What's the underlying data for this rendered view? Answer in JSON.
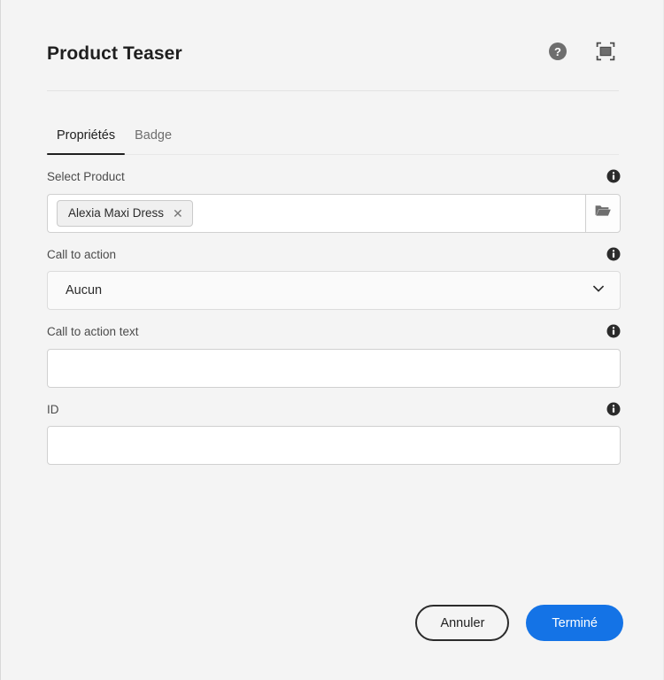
{
  "dialog": {
    "title": "Product Teaser",
    "header_icons": [
      {
        "name": "help-icon",
        "label": "?"
      },
      {
        "name": "fullscreen-icon",
        "label": ""
      }
    ]
  },
  "tabs": [
    {
      "label": "Propriétés",
      "active": true
    },
    {
      "label": "Badge",
      "active": false
    }
  ],
  "fields": {
    "select_product": {
      "label": "Select Product",
      "chip": {
        "text": "Alexia Maxi Dress",
        "remove": "✕"
      },
      "browse_icon": "folder-open-icon",
      "info": "i"
    },
    "call_to_action": {
      "label": "Call to action",
      "value": "Aucun",
      "options": [
        "Aucun"
      ],
      "info": "i"
    },
    "call_to_action_text": {
      "label": "Call to action text",
      "value": "",
      "placeholder": "",
      "info": "i"
    },
    "id": {
      "label": "ID",
      "value": "",
      "placeholder": "",
      "info": "i"
    }
  },
  "footer": {
    "cancel_label": "Annuler",
    "done_label": "Terminé"
  },
  "colors": {
    "primary": "#1473e6",
    "background": "#f4f4f4",
    "text": "#1f1f1f",
    "muted_text": "#6e6e6e"
  }
}
